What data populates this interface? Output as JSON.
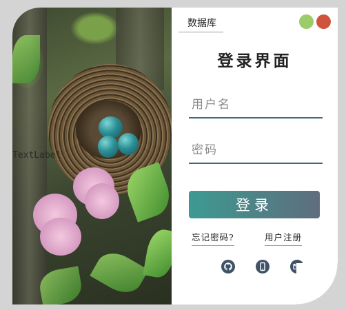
{
  "window": {
    "app_name": "数据库",
    "controls": [
      "minimize-dot",
      "close-dot"
    ]
  },
  "photo": {
    "overlay_text": "TextLabel",
    "description_icon": "bird-nest-photo"
  },
  "login": {
    "title": "登录界面",
    "username_placeholder": "用户名",
    "password_placeholder": "密码",
    "login_label": "登录",
    "forgot_label": "忘记密码?",
    "register_label": "用户注册"
  },
  "social": {
    "icons": [
      "github-icon",
      "phone-icon",
      "mail-icon"
    ]
  },
  "colors": {
    "accent_start": "#3d9a92",
    "accent_end": "#5f6d7e",
    "underline": "#3c6a7a",
    "dot_green": "#9ccb6a",
    "dot_red": "#d0543b"
  }
}
